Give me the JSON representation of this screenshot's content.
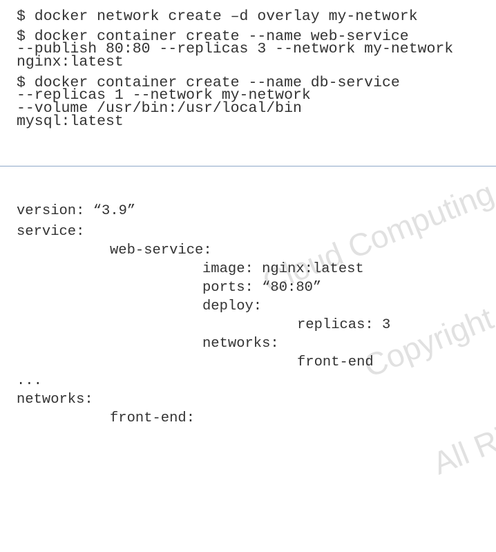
{
  "commands": {
    "cmd1": "$ docker network create –d overlay my-network",
    "cmd2": [
      "$ docker container create --name web-service",
      "--publish 80:80 --replicas 3 --network my-network",
      "nginx:latest"
    ],
    "cmd3": [
      "$ docker container create --name db-service",
      "--replicas 1 --network my-network",
      "--volume /usr/bin:/usr/local/bin",
      "mysql:latest"
    ]
  },
  "yaml": [
    "version: “3.9”",
    "service:",
    "web-service:",
    "image: nginx:latest",
    "ports: “80:80”",
    "deploy:",
    "replicas: 3",
    "networks:",
    "front-end",
    "...",
    "networks:",
    "front-end:"
  ],
  "watermark": {
    "line1": "Cloud Computing",
    "line2": "Copyright R",
    "line3": "All Rights R"
  }
}
